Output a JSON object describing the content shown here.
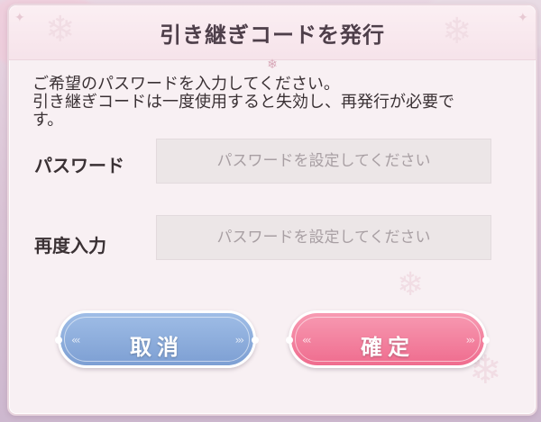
{
  "dialog": {
    "title": "引き継ぎコードを発行",
    "message": [
      "ご希望のパスワードを入力してください。",
      "引き継ぎコードは一度使用すると失効し、再発行が必要で",
      "す。"
    ]
  },
  "form": {
    "password": {
      "label": "パスワード",
      "placeholder": "パスワードを設定してください",
      "value": ""
    },
    "confirm": {
      "label": "再度入力",
      "placeholder": "パスワードを設定してください",
      "value": ""
    }
  },
  "buttons": {
    "cancel": "取消",
    "ok": "確定"
  },
  "colors": {
    "cancel_button": "#86a7d9",
    "ok_button": "#f27b98",
    "panel_bg": "#f8f0f3"
  }
}
